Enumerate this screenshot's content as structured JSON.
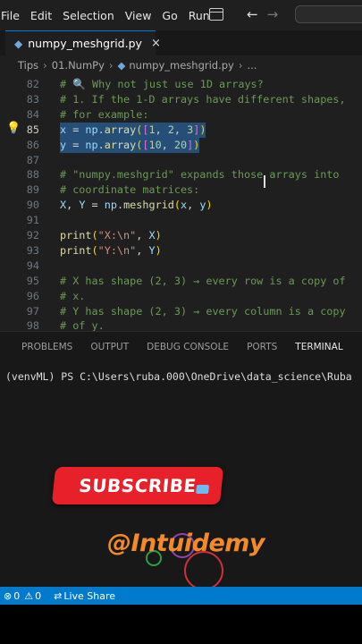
{
  "menu": [
    "File",
    "Edit",
    "Selection",
    "View",
    "Go",
    "Run"
  ],
  "tab": {
    "filename": "numpy_meshgrid.py",
    "close": "×"
  },
  "breadcrumb": [
    "Tips",
    "01.NumPy",
    "numpy_meshgrid.py",
    "..."
  ],
  "editor": {
    "lines": [
      {
        "n": "82",
        "parts": [
          [
            "cm",
            "# 🔍 Why not just use 1D arrays?"
          ]
        ]
      },
      {
        "n": "83",
        "parts": [
          [
            "cm",
            "# 1. If the 1-D arrays have different shapes,"
          ]
        ]
      },
      {
        "n": "84",
        "parts": [
          [
            "cm",
            "# for example:"
          ]
        ]
      },
      {
        "n": "85",
        "active": true,
        "sel": true,
        "parts": [
          [
            "kw",
            "x"
          ],
          [
            "op",
            " = "
          ],
          [
            "kw",
            "np"
          ],
          [
            "op",
            "."
          ],
          [
            "fn",
            "array"
          ],
          [
            "br0",
            "("
          ],
          [
            "br1",
            "["
          ],
          [
            "num",
            "1"
          ],
          [
            "op",
            ", "
          ],
          [
            "num",
            "2"
          ],
          [
            "op",
            ", "
          ],
          [
            "num",
            "3"
          ],
          [
            "br1",
            "]"
          ],
          [
            "br0",
            ")"
          ]
        ]
      },
      {
        "n": "86",
        "sel": true,
        "parts": [
          [
            "kw",
            "y"
          ],
          [
            "op",
            " = "
          ],
          [
            "kw",
            "np"
          ],
          [
            "op",
            "."
          ],
          [
            "fn",
            "array"
          ],
          [
            "br0",
            "("
          ],
          [
            "br1",
            "["
          ],
          [
            "num",
            "10"
          ],
          [
            "op",
            ", "
          ],
          [
            "num",
            "20"
          ],
          [
            "br1",
            "]"
          ],
          [
            "br0",
            ")"
          ]
        ]
      },
      {
        "n": "87",
        "parts": []
      },
      {
        "n": "88",
        "parts": [
          [
            "cm",
            "# \"numpy.meshgrid\" expands those arrays into"
          ]
        ]
      },
      {
        "n": "89",
        "parts": [
          [
            "cm",
            "# coordinate matrices:"
          ]
        ]
      },
      {
        "n": "90",
        "parts": [
          [
            "kw",
            "X"
          ],
          [
            "op",
            ", "
          ],
          [
            "kw",
            "Y"
          ],
          [
            "op",
            " = "
          ],
          [
            "kw",
            "np"
          ],
          [
            "op",
            "."
          ],
          [
            "fn",
            "meshgrid"
          ],
          [
            "br0",
            "("
          ],
          [
            "kw",
            "x"
          ],
          [
            "op",
            ", "
          ],
          [
            "kw",
            "y"
          ],
          [
            "br0",
            ")"
          ]
        ]
      },
      {
        "n": "91",
        "parts": []
      },
      {
        "n": "92",
        "parts": [
          [
            "fn",
            "print"
          ],
          [
            "br0",
            "("
          ],
          [
            "str",
            "\"X:\\n\""
          ],
          [
            "op",
            ", "
          ],
          [
            "kw",
            "X"
          ],
          [
            "br0",
            ")"
          ]
        ]
      },
      {
        "n": "93",
        "parts": [
          [
            "fn",
            "print"
          ],
          [
            "br0",
            "("
          ],
          [
            "str",
            "\"Y:\\n\""
          ],
          [
            "op",
            ", "
          ],
          [
            "kw",
            "Y"
          ],
          [
            "br0",
            ")"
          ]
        ]
      },
      {
        "n": "94",
        "parts": []
      },
      {
        "n": "95",
        "parts": [
          [
            "cm",
            "# X has shape (2, 3) → every row is a copy of"
          ]
        ]
      },
      {
        "n": "96",
        "parts": [
          [
            "cm",
            "# x."
          ]
        ]
      },
      {
        "n": "97",
        "parts": [
          [
            "cm",
            "# Y has shape (2, 3) → every column is a copy"
          ]
        ]
      },
      {
        "n": "98",
        "parts": [
          [
            "cm",
            "# of y."
          ]
        ]
      }
    ]
  },
  "panel": {
    "tabs": [
      "PROBLEMS",
      "OUTPUT",
      "DEBUG CONSOLE",
      "PORTS",
      "TERMINAL"
    ],
    "active_tab": "TERMINAL"
  },
  "terminal": {
    "prompt": "(venvML) PS C:\\Users\\ruba.000\\OneDrive\\data_science\\Ruba"
  },
  "overlay": {
    "subscribe": "SUBSCRIBE",
    "watermark": "@Intuidemy"
  },
  "status": {
    "errors": "0",
    "warnings": "0",
    "liveshare": "Live Share"
  },
  "colors": {
    "accent": "#007acc",
    "subscribe": "#e8202a",
    "watermark": "#f28a2a"
  }
}
